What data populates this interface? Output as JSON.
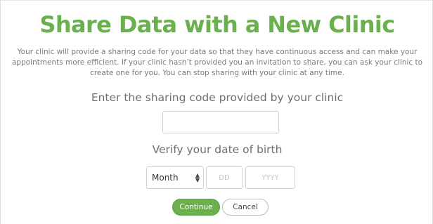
{
  "page": {
    "title": "Share Data with a New Clinic",
    "description": "Your clinic will provide a sharing code for your data so that they have continuous access and can make your appointments more efficient. If your clinic hasn’t provided you an invitation to share, you can ask your clinic to create one for you. You can stop sharing with your clinic at any time."
  },
  "sharing_code": {
    "label": "Enter the sharing code provided by your clinic",
    "value": "",
    "placeholder": ""
  },
  "dob": {
    "label": "Verify your date of birth",
    "month_selected": "Month",
    "day_placeholder": "DD",
    "year_placeholder": "YYYY"
  },
  "actions": {
    "continue_label": "Continue",
    "cancel_label": "Cancel"
  },
  "colors": {
    "accent": "#6ab04c",
    "text_muted": "#7a7a7a",
    "border": "#cfcfcf"
  },
  "icons": {
    "month_select": "select-arrows-icon"
  }
}
